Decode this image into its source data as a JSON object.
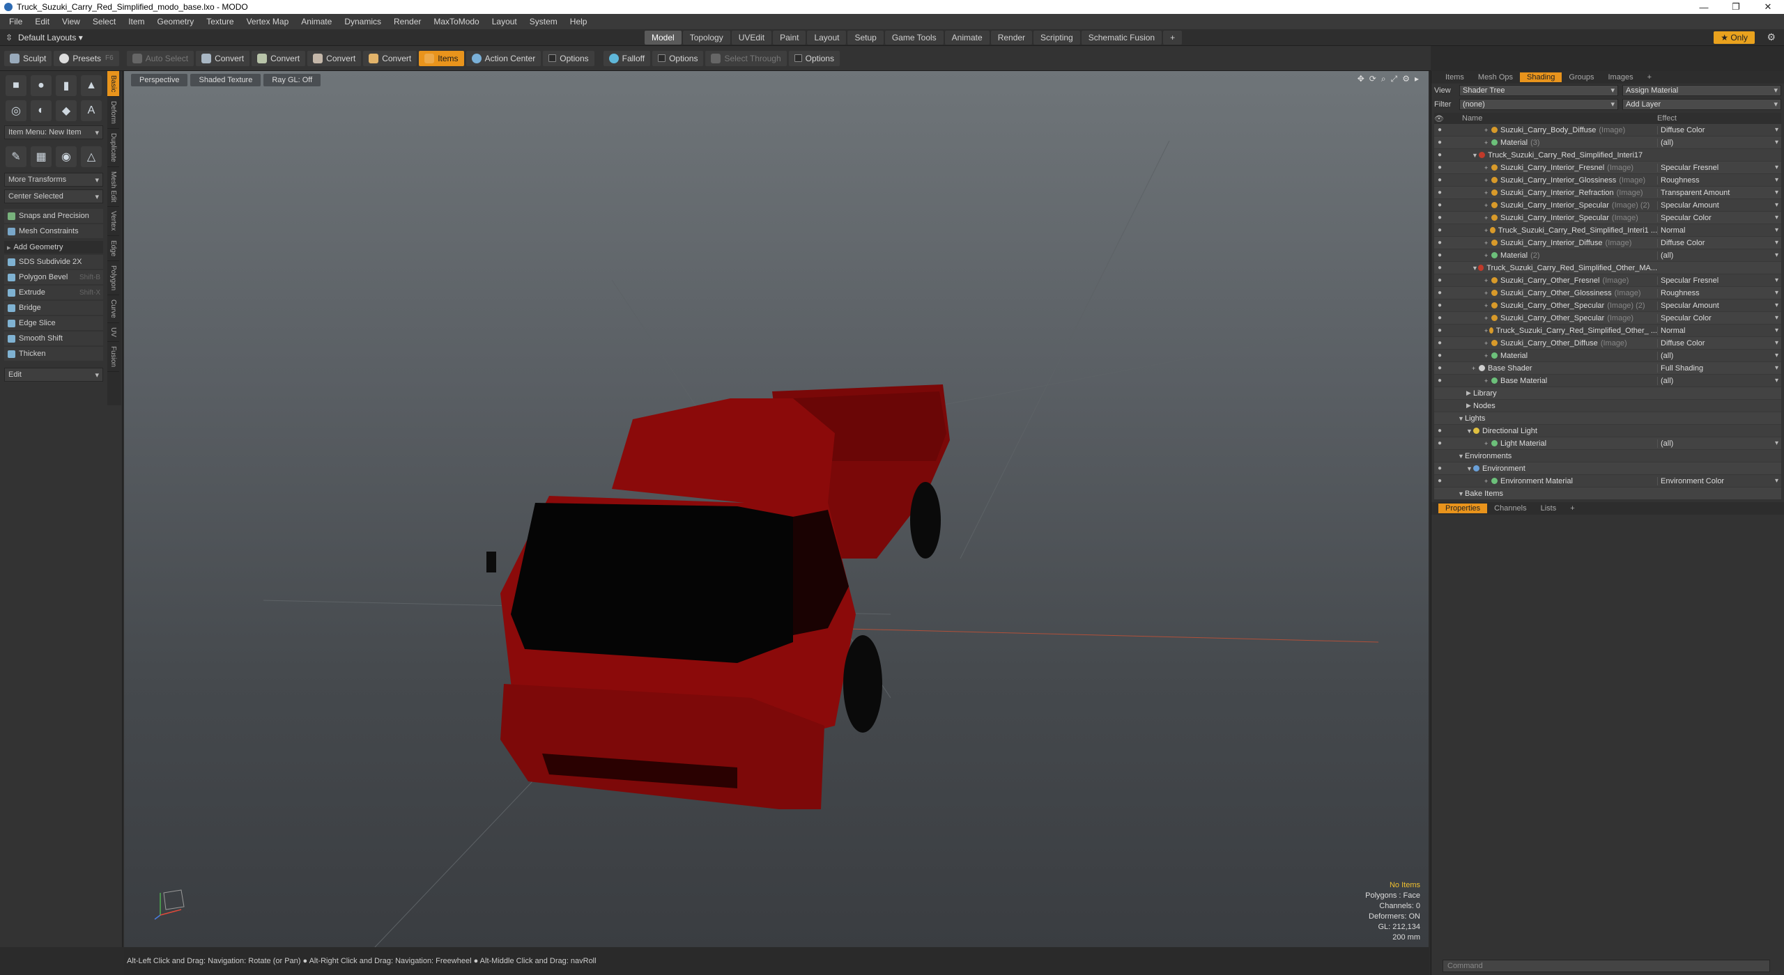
{
  "window": {
    "title": "Truck_Suzuki_Carry_Red_Simplified_modo_base.lxo - MODO",
    "min": "—",
    "max": "❐",
    "close": "✕"
  },
  "menu": [
    "File",
    "Edit",
    "View",
    "Select",
    "Item",
    "Geometry",
    "Texture",
    "Vertex Map",
    "Animate",
    "Dynamics",
    "Render",
    "MaxToModo",
    "Layout",
    "System",
    "Help"
  ],
  "layout": {
    "selector": "Default Layouts ▾",
    "tabs": [
      "Model",
      "Topology",
      "UVEdit",
      "Paint",
      "Layout",
      "Setup",
      "Game Tools",
      "Animate",
      "Render",
      "Scripting",
      "Schematic Fusion",
      "+"
    ],
    "active": "Model",
    "only": "★ Only"
  },
  "toolbar": {
    "sculpt": "Sculpt",
    "presets": "Presets",
    "presets_key": "F6",
    "auto_select": "Auto Select",
    "convert1": "Convert",
    "convert2": "Convert",
    "convert3": "Convert",
    "convert4": "Convert",
    "items": "Items",
    "action_center": "Action Center",
    "options1": "Options",
    "falloff": "Falloff",
    "options2": "Options",
    "select_through": "Select Through",
    "options3": "Options"
  },
  "left": {
    "item_menu": "Item Menu: New Item",
    "more_transforms": "More Transforms",
    "center_selected": "Center Selected",
    "snaps": "Snaps and Precision",
    "mesh_constraints": "Mesh Constraints",
    "add_geometry": "Add Geometry",
    "tools": [
      {
        "label": "SDS Subdivide 2X",
        "key": ""
      },
      {
        "label": "Polygon Bevel",
        "key": "Shift-B"
      },
      {
        "label": "Extrude",
        "key": "Shift-X"
      },
      {
        "label": "Bridge",
        "key": ""
      },
      {
        "label": "Edge Slice",
        "key": ""
      },
      {
        "label": "Smooth Shift",
        "key": ""
      },
      {
        "label": "Thicken",
        "key": ""
      }
    ],
    "edit": "Edit",
    "vtabs": [
      "Basic",
      "Deform",
      "Duplicate",
      "Mesh Edit",
      "Vertex",
      "Edge",
      "Polygon",
      "Curve",
      "UV",
      "Fusion"
    ]
  },
  "viewport": {
    "tabs": [
      "Perspective",
      "Shaded Texture",
      "Ray GL: Off"
    ],
    "hud": {
      "items": "No Items",
      "polygons": "Polygons : Face",
      "channels": "Channels: 0",
      "deformers": "Deformers: ON",
      "gl": "GL: 212,134",
      "scale": "200 mm"
    },
    "colors": {
      "truck": "#8b0a0a",
      "truck_dark": "#5a0505"
    }
  },
  "status": "Alt-Left Click and Drag: Navigation: Rotate (or Pan) ● Alt-Right Click and Drag: Navigation: Freewheel ● Alt-Middle Click and Drag: navRoll",
  "right": {
    "tabs": [
      "Items",
      "Mesh Ops",
      "Shading",
      "Groups",
      "Images",
      "+"
    ],
    "active_tab": "Shading",
    "view_label": "View",
    "view_value": "Shader Tree",
    "assign_material": "Assign Material",
    "filter_label": "Filter",
    "filter_value": "(none)",
    "add_layer": "Add Layer",
    "col_name": "Name",
    "col_effect": "Effect",
    "rows": [
      {
        "name": "Suzuki_Carry_Body_Diffuse",
        "suffix": "(Image)",
        "effect": "Diffuse Color",
        "type": "img"
      },
      {
        "name": "Material",
        "suffix": "(3)",
        "effect": "(all)",
        "type": "mat"
      },
      {
        "name": "Truck_Suzuki_Carry_Red_Simplified_Interi17",
        "suffix": "",
        "effect": "",
        "type": "grp"
      },
      {
        "name": "Suzuki_Carry_Interior_Fresnel",
        "suffix": "(Image)",
        "effect": "Specular Fresnel",
        "type": "img"
      },
      {
        "name": "Suzuki_Carry_Interior_Glossiness",
        "suffix": "(Image)",
        "effect": "Roughness",
        "type": "img"
      },
      {
        "name": "Suzuki_Carry_Interior_Refraction",
        "suffix": "(Image)",
        "effect": "Transparent Amount",
        "type": "img"
      },
      {
        "name": "Suzuki_Carry_Interior_Specular",
        "suffix": "(Image) (2)",
        "effect": "Specular Amount",
        "type": "img"
      },
      {
        "name": "Suzuki_Carry_Interior_Specular",
        "suffix": "(Image)",
        "effect": "Specular Color",
        "type": "img"
      },
      {
        "name": "Truck_Suzuki_Carry_Red_Simplified_Interi1 ...",
        "suffix": "",
        "effect": "Normal",
        "type": "img"
      },
      {
        "name": "Suzuki_Carry_Interior_Diffuse",
        "suffix": "(Image)",
        "effect": "Diffuse Color",
        "type": "img"
      },
      {
        "name": "Material",
        "suffix": "(2)",
        "effect": "(all)",
        "type": "mat"
      },
      {
        "name": "Truck_Suzuki_Carry_Red_Simplified_Other_MA...",
        "suffix": "",
        "effect": "",
        "type": "grp"
      },
      {
        "name": "Suzuki_Carry_Other_Fresnel",
        "suffix": "(Image)",
        "effect": "Specular Fresnel",
        "type": "img"
      },
      {
        "name": "Suzuki_Carry_Other_Glossiness",
        "suffix": "(Image)",
        "effect": "Roughness",
        "type": "img"
      },
      {
        "name": "Suzuki_Carry_Other_Specular",
        "suffix": "(Image) (2)",
        "effect": "Specular Amount",
        "type": "img"
      },
      {
        "name": "Suzuki_Carry_Other_Specular",
        "suffix": "(Image)",
        "effect": "Specular Color",
        "type": "img"
      },
      {
        "name": "Truck_Suzuki_Carry_Red_Simplified_Other_ ...",
        "suffix": "",
        "effect": "Normal",
        "type": "img"
      },
      {
        "name": "Suzuki_Carry_Other_Diffuse",
        "suffix": "(Image)",
        "effect": "Diffuse Color",
        "type": "img"
      },
      {
        "name": "Material",
        "suffix": "",
        "effect": "(all)",
        "type": "mat"
      },
      {
        "name": "Base Shader",
        "suffix": "",
        "effect": "Full Shading",
        "type": "shader"
      },
      {
        "name": "Base Material",
        "suffix": "",
        "effect": "(all)",
        "type": "mat"
      },
      {
        "name": "Library",
        "suffix": "",
        "effect": "",
        "type": "folder"
      },
      {
        "name": "Nodes",
        "suffix": "",
        "effect": "",
        "type": "folder"
      },
      {
        "name": "Lights",
        "suffix": "",
        "effect": "",
        "type": "section"
      },
      {
        "name": "Directional Light",
        "suffix": "",
        "effect": "",
        "type": "light"
      },
      {
        "name": "Light Material",
        "suffix": "",
        "effect": "(all)",
        "type": "mat"
      },
      {
        "name": "Environments",
        "suffix": "",
        "effect": "",
        "type": "section"
      },
      {
        "name": "Environment",
        "suffix": "",
        "effect": "",
        "type": "env"
      },
      {
        "name": "Environment Material",
        "suffix": "",
        "effect": "Environment Color",
        "type": "mat"
      },
      {
        "name": "Bake Items",
        "suffix": "",
        "effect": "",
        "type": "section"
      }
    ],
    "prop_tabs": [
      "Properties",
      "Channels",
      "Lists",
      "+"
    ],
    "command_placeholder": "Command"
  }
}
